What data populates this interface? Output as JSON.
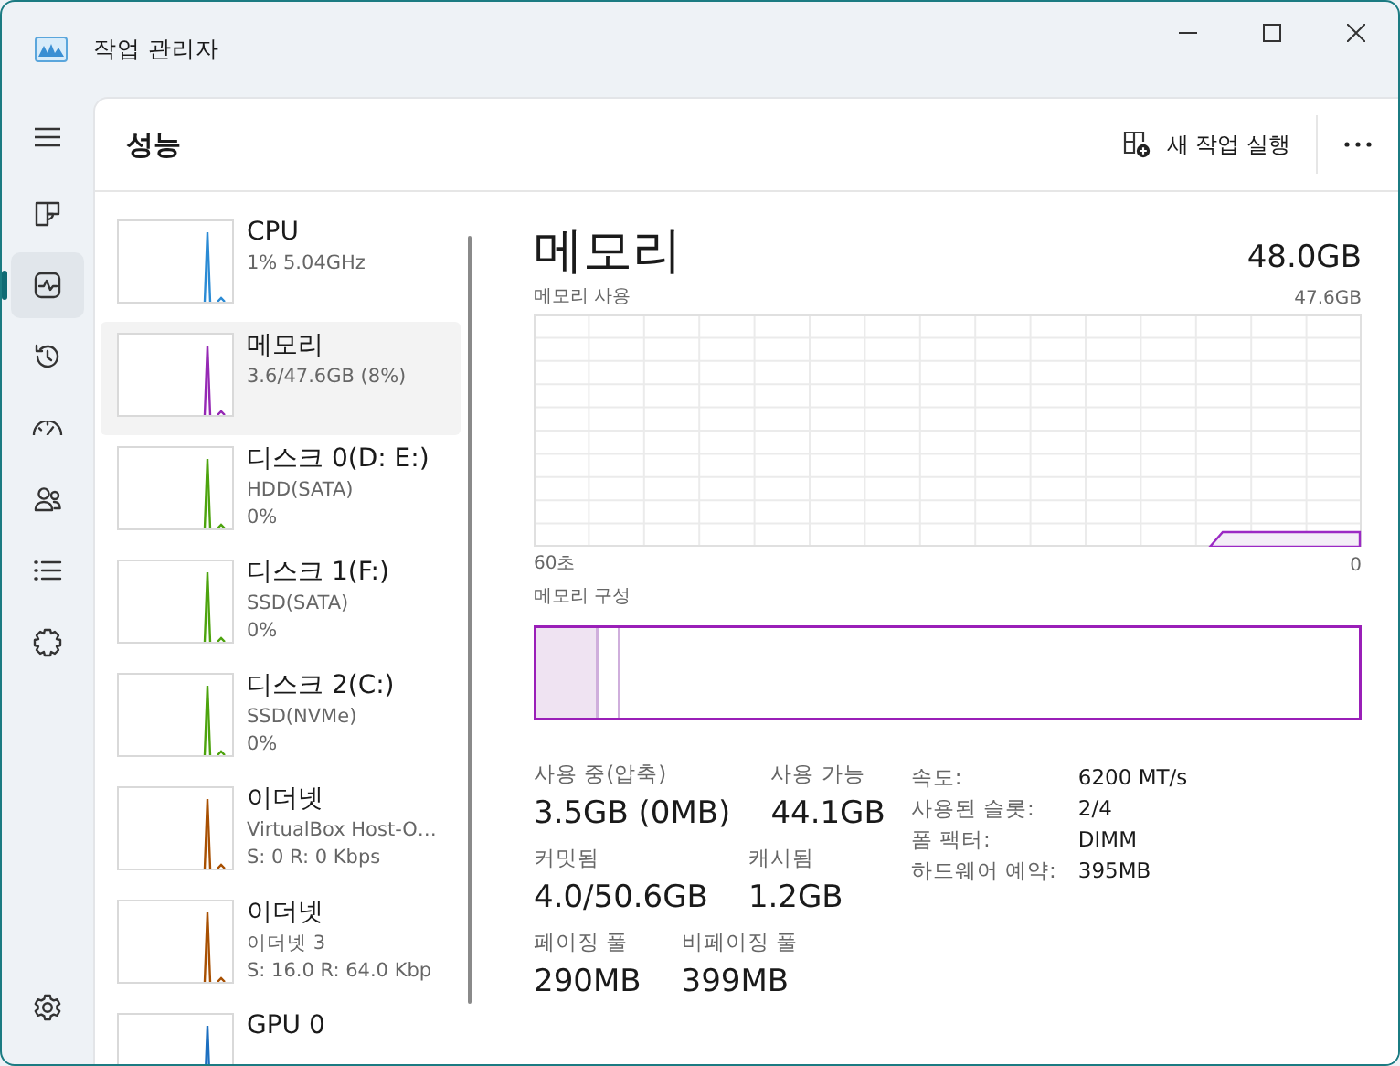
{
  "window": {
    "title": "작업 관리자"
  },
  "nav": {
    "items": [
      {
        "kind": "processes",
        "selected": false
      },
      {
        "kind": "performance",
        "selected": true
      },
      {
        "kind": "history",
        "selected": false
      },
      {
        "kind": "startup",
        "selected": false
      },
      {
        "kind": "users",
        "selected": false
      },
      {
        "kind": "details",
        "selected": false
      },
      {
        "kind": "services",
        "selected": false
      }
    ]
  },
  "header": {
    "title": "성능",
    "run_task": "새 작업 실행"
  },
  "devices": [
    {
      "name": "CPU",
      "lines": [
        "1% 5.04GHz"
      ],
      "color": "#2a8ad4",
      "selected": false
    },
    {
      "name": "메모리",
      "lines": [
        "3.6/47.6GB (8%)"
      ],
      "color": "#9528b4",
      "selected": true
    },
    {
      "name": "디스크 0(D: E:)",
      "lines": [
        "HDD(SATA)",
        "0%"
      ],
      "color": "#4ca30d",
      "selected": false
    },
    {
      "name": "디스크 1(F:)",
      "lines": [
        "SSD(SATA)",
        "0%"
      ],
      "color": "#4ca30d",
      "selected": false
    },
    {
      "name": "디스크 2(C:)",
      "lines": [
        "SSD(NVMe)",
        "0%"
      ],
      "color": "#4ca30d",
      "selected": false
    },
    {
      "name": "이더넷",
      "lines": [
        "VirtualBox Host-O…",
        "S: 0 R: 0 Kbps"
      ],
      "color": "#a74f01",
      "selected": false
    },
    {
      "name": "이더넷",
      "lines": [
        "이더넷 3",
        "S: 16.0 R: 64.0 Kbp"
      ],
      "color": "#a74f01",
      "selected": false
    },
    {
      "name": "GPU 0",
      "color": "#1c6fc0",
      "selected": false
    }
  ],
  "detail": {
    "title": "메모리",
    "total": "48.0GB",
    "usage_label": "메모리 사용",
    "usage_max": "47.6GB",
    "axis_start": "60초",
    "axis_end": "0",
    "composition_label": "메모리 구성",
    "stat_rows": [
      [
        {
          "label": "사용 중(압축)",
          "value": "3.5GB (0MB)"
        },
        {
          "label": "사용 가능",
          "value": "44.1GB"
        }
      ],
      [
        {
          "label": "커밋됨",
          "value": "4.0/50.6GB"
        },
        {
          "label": "캐시됨",
          "value": "1.2GB"
        }
      ],
      [
        {
          "label": "페이징 풀",
          "value": "290MB"
        },
        {
          "label": "비페이징 풀",
          "value": "399MB"
        }
      ]
    ],
    "properties": [
      {
        "label": "속도:",
        "value": "6200 MT/s"
      },
      {
        "label": "사용된 슬롯:",
        "value": "2/4"
      },
      {
        "label": "폼 팩터:",
        "value": "DIMM"
      },
      {
        "label": "하드웨어 예약:",
        "value": "395MB"
      }
    ]
  }
}
